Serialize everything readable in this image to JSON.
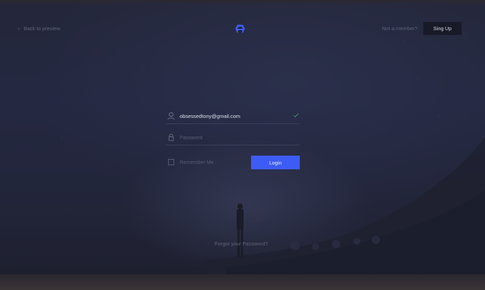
{
  "header": {
    "back_label": "Back to preview",
    "not_member_label": "Not a member?",
    "signup_label": "Sing Up"
  },
  "form": {
    "email": {
      "value": "obsessedtony@gmail.com",
      "icon": "user-icon",
      "valid": true
    },
    "password": {
      "placeholder": "Password",
      "icon": "lock-icon"
    },
    "remember_label": "Remember Me",
    "remember_checked": false,
    "login_label": "Login"
  },
  "footer": {
    "forgot_label": "Forgot your Password?"
  },
  "colors": {
    "accent": "#3d5cf5",
    "background": "#232639",
    "valid_check": "#3f8f6a"
  }
}
